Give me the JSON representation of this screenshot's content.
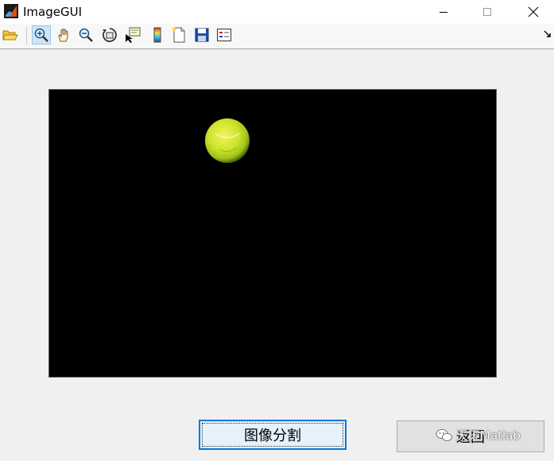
{
  "window": {
    "title": "ImageGUI",
    "controls": [
      "minimize",
      "maximize",
      "close"
    ]
  },
  "toolbar": {
    "buttons": [
      {
        "name": "open-file",
        "icon": "folder-open-icon",
        "active": false
      },
      {
        "name": "zoom-in",
        "icon": "zoom-in-icon",
        "active": true
      },
      {
        "name": "pan",
        "icon": "hand-icon",
        "active": false
      },
      {
        "name": "zoom-out",
        "icon": "zoom-out-icon",
        "active": false
      },
      {
        "name": "rotate-3d",
        "icon": "rotate-3d-icon",
        "active": false
      },
      {
        "name": "data-cursor",
        "icon": "data-cursor-icon",
        "active": false
      },
      {
        "name": "insert-colorbar",
        "icon": "colorbar-icon",
        "active": false
      },
      {
        "name": "new-figure",
        "icon": "new-figure-icon",
        "active": false
      },
      {
        "name": "save-figure",
        "icon": "save-icon",
        "active": false
      },
      {
        "name": "insert-legend",
        "icon": "legend-icon",
        "active": false
      }
    ]
  },
  "axes": {
    "background": "#000000",
    "content": "tennis-ball"
  },
  "buttons": {
    "segment_label": "图像分割",
    "back_label": "返回"
  },
  "watermark": {
    "text": "天天Matlab"
  },
  "colors": {
    "ball": "#d4e82a",
    "focus_border": "#0078d7"
  }
}
